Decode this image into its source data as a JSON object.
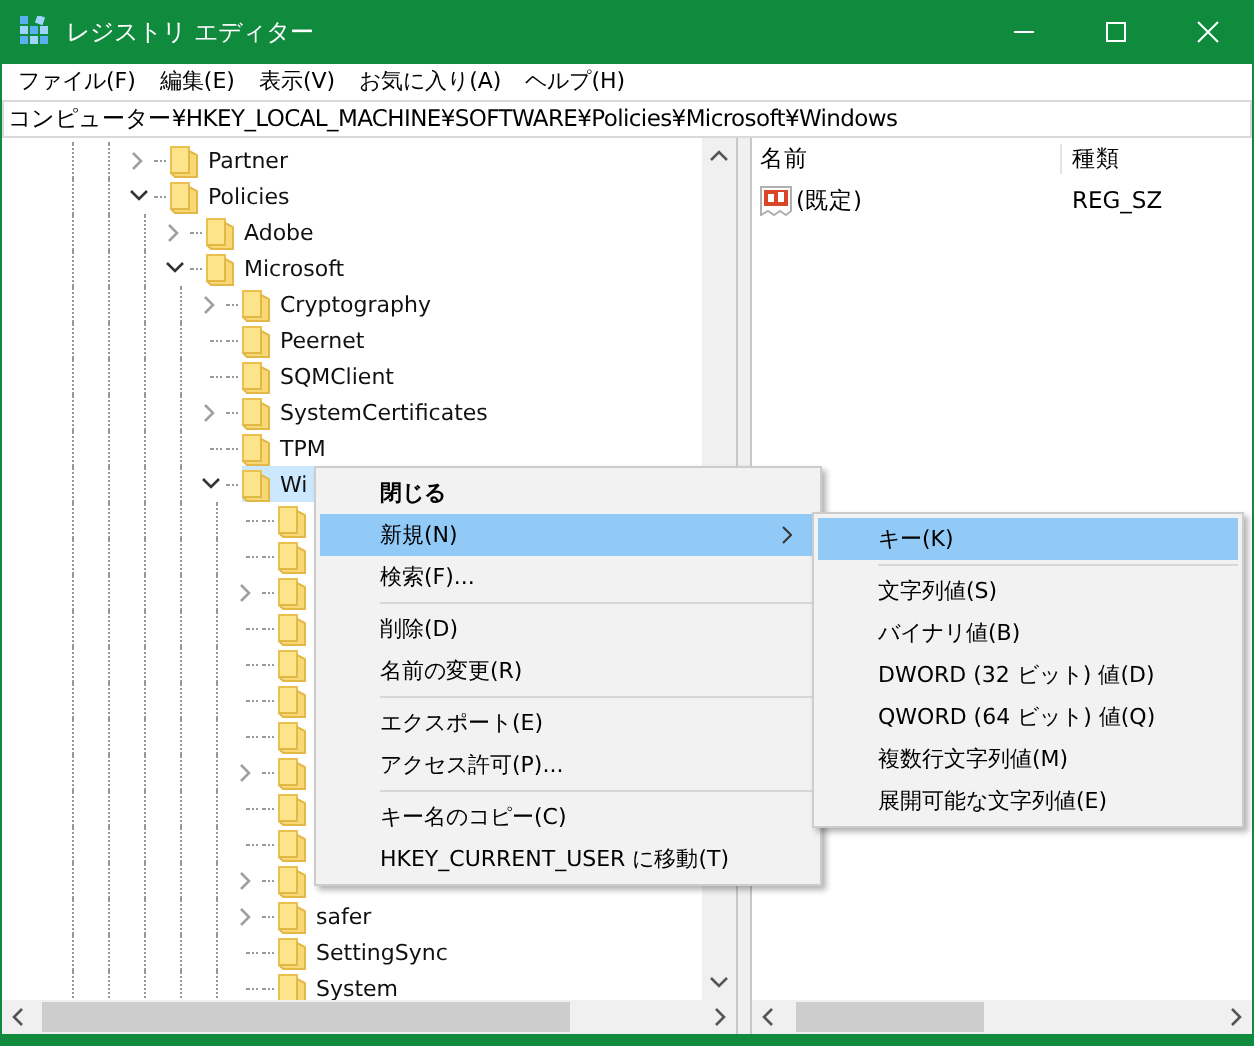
{
  "window": {
    "title": "レジストリ エディター"
  },
  "menu_bar": [
    "ファイル(F)",
    "編集(E)",
    "表示(V)",
    "お気に入り(A)",
    "ヘルプ(H)"
  ],
  "address": "コンピューター¥HKEY_LOCAL_MACHINE¥SOFTWARE¥Policies¥Microsoft¥Windows",
  "tree": [
    {
      "name": "Partner",
      "has_children": true,
      "expanded": false,
      "selected": false
    },
    {
      "name": "Policies",
      "has_children": true,
      "expanded": true,
      "selected": false,
      "children": [
        {
          "name": "Adobe",
          "has_children": true,
          "expanded": false,
          "selected": false
        },
        {
          "name": "Microsoft",
          "has_children": true,
          "expanded": true,
          "selected": false,
          "children": [
            {
              "name": "Cryptography",
              "has_children": true,
              "expanded": false,
              "selected": false
            },
            {
              "name": "Peernet",
              "has_children": false,
              "expanded": false,
              "selected": false
            },
            {
              "name": "SQMClient",
              "has_children": false,
              "expanded": false,
              "selected": false
            },
            {
              "name": "SystemCertificates",
              "has_children": true,
              "expanded": false,
              "selected": false
            },
            {
              "name": "TPM",
              "has_children": false,
              "expanded": false,
              "selected": false
            },
            {
              "name": "Wi",
              "has_children": true,
              "expanded": true,
              "selected": true,
              "children": [
                {
                  "has_children": false,
                  "expanded": false,
                  "selected": false
                },
                {
                  "has_children": false,
                  "expanded": false,
                  "selected": false
                },
                {
                  "has_children": true,
                  "expanded": false,
                  "selected": false
                },
                {
                  "has_children": false,
                  "expanded": false,
                  "selected": false
                },
                {
                  "has_children": false,
                  "expanded": false,
                  "selected": false
                },
                {
                  "has_children": false,
                  "expanded": false,
                  "selected": false
                },
                {
                  "has_children": false,
                  "expanded": false,
                  "selected": false
                },
                {
                  "has_children": true,
                  "expanded": false,
                  "selected": false
                },
                {
                  "has_children": false,
                  "expanded": false,
                  "selected": false
                },
                {
                  "has_children": false,
                  "expanded": false,
                  "selected": false
                },
                {
                  "has_children": true,
                  "expanded": false,
                  "selected": false
                },
                {
                  "name": "safer",
                  "has_children": true,
                  "expanded": false,
                  "selected": false
                },
                {
                  "name": "SettingSync",
                  "has_children": false,
                  "expanded": false,
                  "selected": false
                },
                {
                  "name": "System",
                  "has_children": false,
                  "expanded": false,
                  "selected": false
                }
              ]
            }
          ]
        }
      ]
    }
  ],
  "values": {
    "columns": [
      "名前",
      "種類"
    ],
    "rows": [
      {
        "name": "(既定)",
        "type": "REG_SZ"
      }
    ]
  },
  "context_menu": [
    {
      "kind": "item",
      "label": "閉じる",
      "default": true,
      "submenu": false,
      "selected": false
    },
    {
      "kind": "item",
      "label": "新規(N)",
      "default": false,
      "submenu": true,
      "selected": true
    },
    {
      "kind": "item",
      "label": "検索(F)...",
      "default": false,
      "submenu": false,
      "selected": false
    },
    {
      "kind": "separator"
    },
    {
      "kind": "item",
      "label": "削除(D)",
      "default": false,
      "submenu": false,
      "selected": false
    },
    {
      "kind": "item",
      "label": "名前の変更(R)",
      "default": false,
      "submenu": false,
      "selected": false
    },
    {
      "kind": "separator"
    },
    {
      "kind": "item",
      "label": "エクスポート(E)",
      "default": false,
      "submenu": false,
      "selected": false
    },
    {
      "kind": "item",
      "label": "アクセス許可(P)...",
      "default": false,
      "submenu": false,
      "selected": false
    },
    {
      "kind": "separator"
    },
    {
      "kind": "item",
      "label": "キー名のコピー(C)",
      "default": false,
      "submenu": false,
      "selected": false
    },
    {
      "kind": "item",
      "label": "HKEY_CURRENT_USER に移動(T)",
      "default": false,
      "submenu": false,
      "selected": false
    }
  ],
  "submenu": [
    {
      "kind": "item",
      "label": "キー(K)",
      "selected": true
    },
    {
      "kind": "separator"
    },
    {
      "kind": "item",
      "label": "文字列値(S)",
      "selected": false
    },
    {
      "kind": "item",
      "label": "バイナリ値(B)",
      "selected": false
    },
    {
      "kind": "item",
      "label": "DWORD (32 ビット) 値(D)",
      "selected": false
    },
    {
      "kind": "item",
      "label": "QWORD (64 ビット) 値(Q)",
      "selected": false
    },
    {
      "kind": "item",
      "label": "複数行文字列値(M)",
      "selected": false
    },
    {
      "kind": "item",
      "label": "展開可能な文字列値(E)",
      "selected": false
    }
  ]
}
